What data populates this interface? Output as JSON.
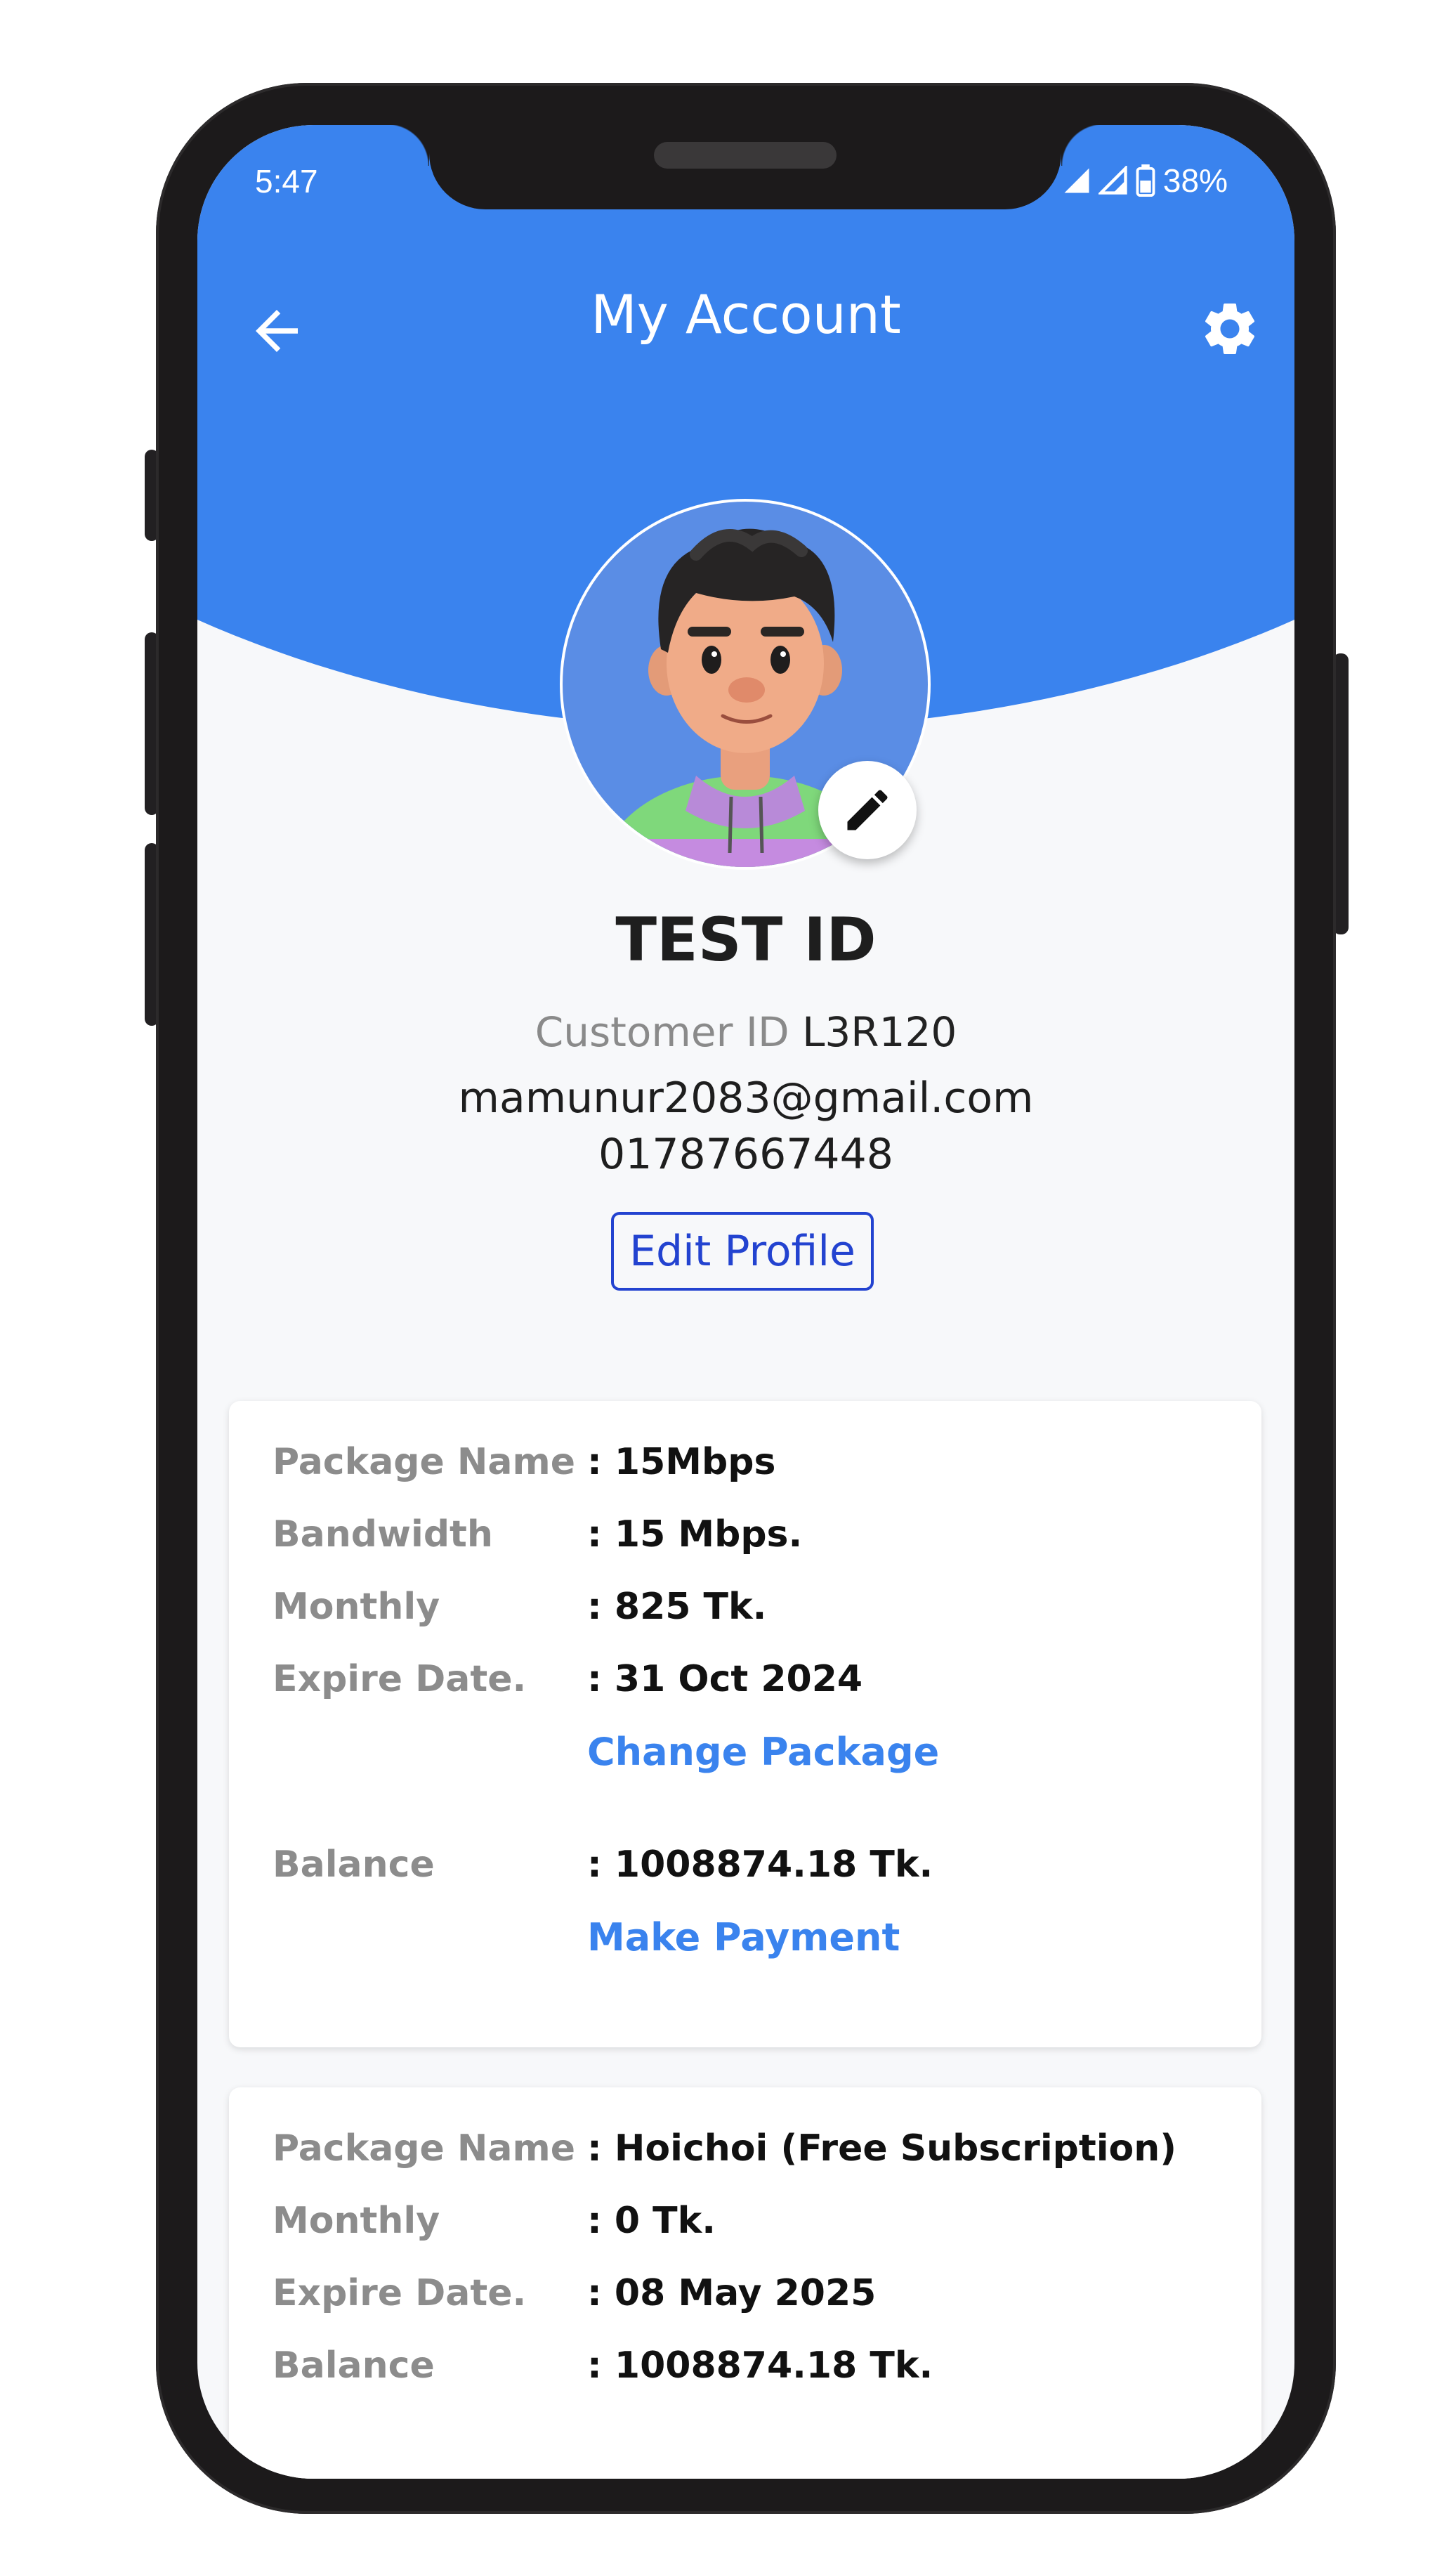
{
  "status_bar": {
    "time": "5:47",
    "battery": "38%"
  },
  "toolbar": {
    "title": "My Account"
  },
  "icons": {
    "back": "arrow-left-icon",
    "settings": "gear-icon",
    "edit": "pencil-icon"
  },
  "colors": {
    "primary": "#3a83ee",
    "button_border": "#2343d0",
    "label": "#8c8c8c"
  },
  "profile": {
    "name": "TEST ID",
    "customer_id_label": "Customer ID",
    "customer_id": "L3R120",
    "email": "mamunur2083@gmail.com",
    "phone": "01787667448",
    "edit_button": "Edit Profile"
  },
  "packages": [
    {
      "rows": [
        {
          "label": "Package Name",
          "value": ": 15Mbps"
        },
        {
          "label": "Bandwidth",
          "value": ": 15 Mbps."
        },
        {
          "label": "Monthly",
          "value": ": 825 Tk."
        },
        {
          "label": "Expire Date.",
          "value": ": 31 Oct 2024"
        }
      ],
      "change_package": "Change Package",
      "balance_label": "Balance",
      "balance_value": ": 1008874.18 Tk.",
      "make_payment": "Make Payment"
    },
    {
      "rows": [
        {
          "label": "Package Name",
          "value": ": Hoichoi (Free Subscription)"
        },
        {
          "label": "Monthly",
          "value": ": 0 Tk."
        },
        {
          "label": "Expire Date.",
          "value": ": 08 May 2025"
        },
        {
          "label": "Balance",
          "value": ": 1008874.18 Tk."
        }
      ]
    }
  ]
}
